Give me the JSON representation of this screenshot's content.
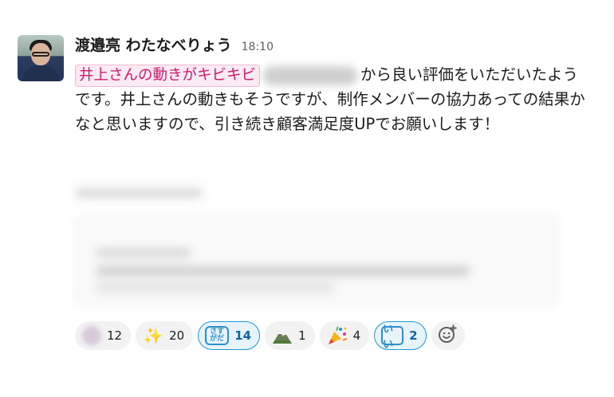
{
  "message": {
    "sender": "渡邉亮 わたなべりょう",
    "timestamp": "18:10",
    "mention": "井上さんの動きがキビキビ",
    "text_after_mention": "から良い評価をいただいたようです。井上さんの動きもそうですが、制作メンバーの協力あっての結果かなと思いますので、引き続き顧客満足度UPでお願いします！"
  },
  "reactions": [
    {
      "emoji": "blurred-emoji",
      "count": "12",
      "active": false
    },
    {
      "emoji": "sparkles",
      "glyph": "✨",
      "count": "20",
      "active": false
    },
    {
      "emoji": "sugoi-text",
      "glyph_lines": [
        "さす",
        "がだ"
      ],
      "count": "14",
      "active": true
    },
    {
      "emoji": "mountain",
      "count": "1",
      "active": false
    },
    {
      "emoji": "party-popper",
      "count": "4",
      "active": false
    },
    {
      "emoji": "ii-text",
      "glyph": "いい",
      "count": "2",
      "active": true
    }
  ],
  "colors": {
    "mention_text": "#d01b6f",
    "mention_bg": "#fdebf3",
    "reaction_active_border": "#1d9bd1",
    "reaction_active_text": "#1264a3"
  }
}
